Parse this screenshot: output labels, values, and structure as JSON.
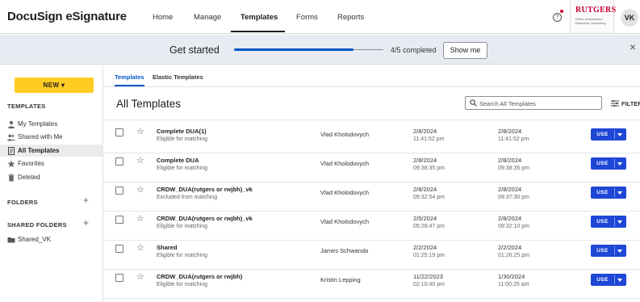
{
  "header": {
    "brand": "DocuSign eSignature",
    "nav": [
      {
        "label": "Home"
      },
      {
        "label": "Manage"
      },
      {
        "label": "Templates",
        "active": true
      },
      {
        "label": "Forms"
      },
      {
        "label": "Reports"
      }
    ],
    "help_icon": "question-circle-icon",
    "org_logo": {
      "name": "RUTGERS",
      "subtitle": "Office of Advanced Research Computing"
    },
    "avatar_initials": "VK"
  },
  "banner": {
    "title": "Get started",
    "progress_fraction": 0.8,
    "progress_text": "4/5 completed",
    "button_label": "Show me",
    "close_icon": "close-icon"
  },
  "sidebar": {
    "new_button": "NEW ▾",
    "templates_heading": "TEMPLATES",
    "items": [
      {
        "label": "My Templates",
        "icon": "person-icon"
      },
      {
        "label": "Shared with Me",
        "icon": "people-icon"
      },
      {
        "label": "All Templates",
        "icon": "template-icon",
        "active": true
      },
      {
        "label": "Favorites",
        "icon": "star-icon"
      },
      {
        "label": "Deleted",
        "icon": "trash-icon"
      }
    ],
    "folders_heading": "FOLDERS",
    "shared_folders_heading": "SHARED FOLDERS",
    "plus": "+",
    "shared_folders": [
      {
        "label": "Shared_VK",
        "icon": "folder-icon"
      }
    ]
  },
  "main": {
    "subtabs": [
      {
        "label": "Templates",
        "active": true
      },
      {
        "label": "Elastic Templates"
      }
    ],
    "title": "All Templates",
    "search_placeholder": "Search All Templates",
    "filter_label": "FILTER",
    "use_label": "USE",
    "rows": [
      {
        "name": "Complete DUA(1)",
        "status": "Eligible for matching",
        "owner": "Vlad Kholodovych",
        "created_date": "2/8/2024",
        "created_time": "11:41:52 pm",
        "modified_date": "2/8/2024",
        "modified_time": "11:41:52 pm"
      },
      {
        "name": "Complete DUA",
        "status": "Eligible for matching",
        "owner": "Vlad Kholodovych",
        "created_date": "2/8/2024",
        "created_time": "09:38:35 pm",
        "modified_date": "2/8/2024",
        "modified_time": "09:38:35 pm"
      },
      {
        "name": "CRDW_DUA(rutgers or rwjbh)_vk",
        "status": "Excluded from matching",
        "owner": "Vlad Kholodovych",
        "created_date": "2/8/2024",
        "created_time": "09:32:54 pm",
        "modified_date": "2/8/2024",
        "modified_time": "09:37:30 pm"
      },
      {
        "name": "CRDW_DUA(rutgers or rwjbh)_vk",
        "status": "Eligible for matching",
        "owner": "Vlad Kholodovych",
        "created_date": "2/5/2024",
        "created_time": "05:28:47 pm",
        "modified_date": "2/8/2024",
        "modified_time": "09:32:10 pm"
      },
      {
        "name": "Shared",
        "status": "Eligible for matching",
        "owner": "James Schwanda",
        "created_date": "2/2/2024",
        "created_time": "01:25:19 pm",
        "modified_date": "2/2/2024",
        "modified_time": "01:26:25 pm"
      },
      {
        "name": "CRDW_DUA(rutgers or rwjbh)",
        "status": "Eligible for matching",
        "owner": "Kristin Lepping",
        "created_date": "11/22/2023",
        "created_time": "02:10:40 pm",
        "modified_date": "1/30/2024",
        "modified_time": "11:00:25 am"
      }
    ]
  },
  "colors": {
    "accent_blue": "#1f47d6",
    "link_blue": "#0057c8",
    "new_button_yellow": "#ffcc22",
    "banner_bg": "#e8ebf1",
    "rutgers_red": "#cc0033"
  }
}
